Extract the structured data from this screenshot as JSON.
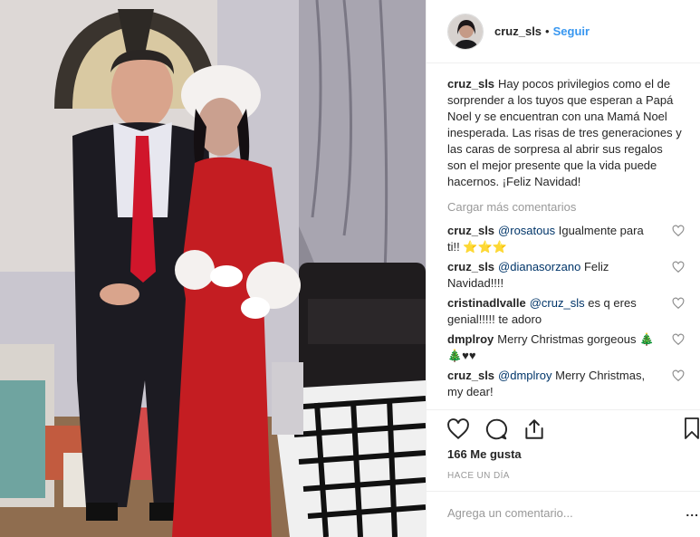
{
  "header": {
    "username": "cruz_sls",
    "separator": "•",
    "follow_label": "Seguir"
  },
  "caption": {
    "username": "cruz_sls",
    "text": "Hay pocos privilegios como el de sorprender a los tuyos que esperan a Papá Noel y se encuentran con una Mamá Noel inesperada. Las risas de tres generaciones y las caras de sorpresa al abrir sus regalos son el mejor presente que la vida puede hacernos. ¡Feliz Navidad!"
  },
  "load_more_label": "Cargar más comentarios",
  "comments": [
    {
      "username": "cruz_sls",
      "mention": "@rosatous",
      "text": "Igualmente para ti!! ⭐⭐⭐"
    },
    {
      "username": "cruz_sls",
      "mention": "@dianasorzano",
      "text": "Feliz Navidad!!!!"
    },
    {
      "username": "cristinadlvalle",
      "mention": "@cruz_sls",
      "text": "es q eres genial!!!!! te adoro"
    },
    {
      "username": "dmplroy",
      "mention": "",
      "text": "Merry Christmas gorgeous 🎄🎄♥♥"
    },
    {
      "username": "cruz_sls",
      "mention": "@dmplroy",
      "text": "Merry Christmas, my dear!"
    }
  ],
  "likes": "166 Me gusta",
  "timestamp": "HACE UN DÍA",
  "add_comment": {
    "placeholder": "Agrega un comentario..."
  },
  "more_options": "...",
  "icons": [
    "heart-icon",
    "comment-icon",
    "share-icon",
    "bookmark-icon"
  ],
  "colors": {
    "link": "#3897f0",
    "mention": "#003569",
    "muted": "#999999",
    "text": "#262626"
  }
}
